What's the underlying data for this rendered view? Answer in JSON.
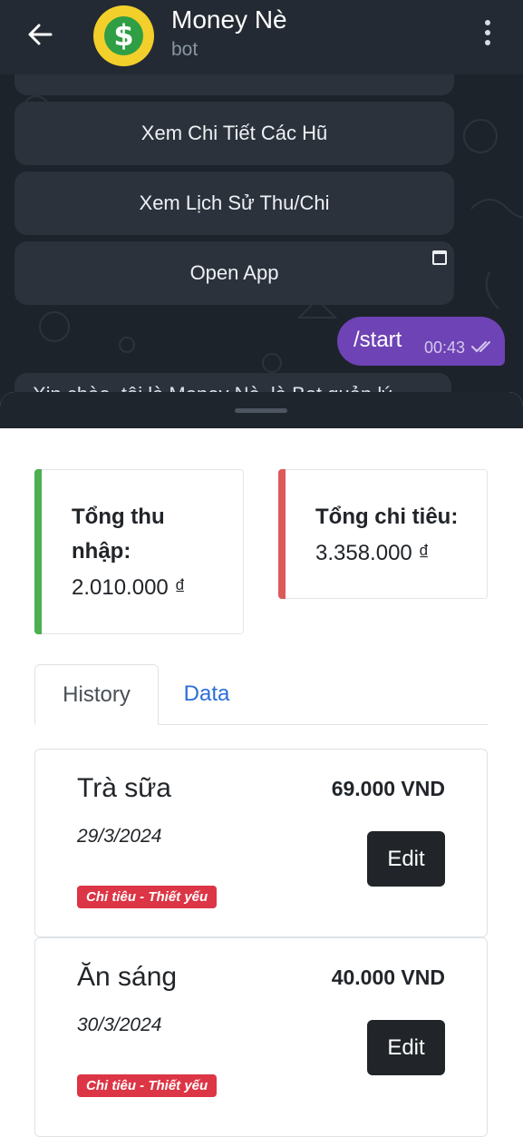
{
  "header": {
    "title": "Money Nè",
    "subtitle": "bot",
    "avatar_symbol": "$"
  },
  "chat": {
    "keyboard_buttons": [
      "Xem Chi Tiết Các Hũ",
      "Xem Lịch Sử Thu/Chi",
      "Open App"
    ],
    "outgoing_message": {
      "text": "/start",
      "time": "00:43"
    },
    "incoming_preview": "Xin chào, tôi là Money Nè, là Bot quản lý"
  },
  "summary": {
    "income_label": "Tổng thu nhập:",
    "income_value": "2.010.000 ₫",
    "expense_label": "Tổng chi tiêu:",
    "expense_value": "3.358.000 ₫",
    "income_color": "#4caf50",
    "expense_color": "#dc5a5a"
  },
  "tabs": [
    {
      "label": "History",
      "active": true
    },
    {
      "label": "Data",
      "active": false
    }
  ],
  "transactions": [
    {
      "name": "Trà sữa",
      "amount": "69.000 VND",
      "date": "29/3/2024",
      "category": "Chi tiêu - Thiết yếu",
      "action": "Edit"
    },
    {
      "name": "Ăn sáng",
      "amount": "40.000 VND",
      "date": "30/3/2024",
      "category": "Chi tiêu - Thiết yếu",
      "action": "Edit"
    }
  ]
}
